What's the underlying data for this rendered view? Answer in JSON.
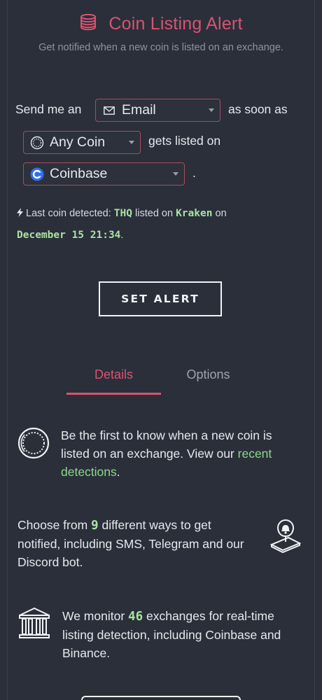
{
  "header": {
    "icon": "coins-icon",
    "title": "Coin Listing Alert",
    "subtitle": "Get notified when a new coin is listed on an exchange."
  },
  "form": {
    "text_send": "Send me an",
    "method": {
      "icon": "envelope-icon",
      "value": "Email"
    },
    "text_asap": "as soon as",
    "coin": {
      "icon": "coin-icon",
      "value": "Any Coin"
    },
    "text_listed": "gets listed on",
    "exchange": {
      "icon": "coinbase-icon",
      "value": "Coinbase"
    },
    "period": "."
  },
  "last_detection": {
    "icon": "bolt-icon",
    "prefix": "Last coin detected:",
    "coin": "THQ",
    "mid": "listed on",
    "exchange": "Kraken",
    "on": "on",
    "date": "December 15 21:34",
    "end": "."
  },
  "set_alert_label": "SET ALERT",
  "tabs": [
    {
      "label": "Details",
      "active": true
    },
    {
      "label": "Options",
      "active": false
    }
  ],
  "features": [
    {
      "icon": "coin-icon",
      "text_a": "Be the first to know when a new coin is listed on an exchange. View our",
      "link": "recent detections",
      "text_b": "."
    },
    {
      "icon": "phone-bell-icon",
      "text_a": "Choose from",
      "number": "9",
      "text_b": "different ways to get notified, including SMS, Telegram and our Discord bot."
    },
    {
      "icon": "bank-icon",
      "text_a": "We monitor",
      "number": "46",
      "text_b": "exchanges for real-time listing detection, including Coinbase and Binance."
    }
  ],
  "colors": {
    "background": "#2a2f3a",
    "accent": "#d9536f",
    "highlight": "#a9e3a0"
  }
}
